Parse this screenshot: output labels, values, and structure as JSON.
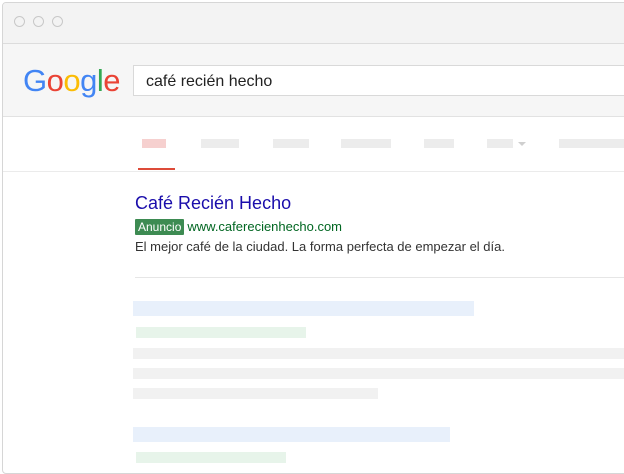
{
  "browser": {
    "window_buttons": [
      "close",
      "minimize",
      "maximize"
    ]
  },
  "search": {
    "logo_letters": [
      {
        "char": "G",
        "color": "#4285F4"
      },
      {
        "char": "o",
        "color": "#EA4335"
      },
      {
        "char": "o",
        "color": "#FBBC05"
      },
      {
        "char": "g",
        "color": "#4285F4"
      },
      {
        "char": "l",
        "color": "#34A853"
      },
      {
        "char": "e",
        "color": "#EA4335"
      }
    ],
    "query": "café recién hecho"
  },
  "ad_result": {
    "title": "Café Recién Hecho",
    "badge": "Anuncio",
    "url": "www.caferecienhecho.com",
    "description": "El mejor café de la ciudad. La forma perfecta de empezar el día."
  },
  "colors": {
    "link": "#1a0dab",
    "url_green": "#006621",
    "badge_green": "#3d8b52",
    "active_tab": "#dd4b39"
  }
}
